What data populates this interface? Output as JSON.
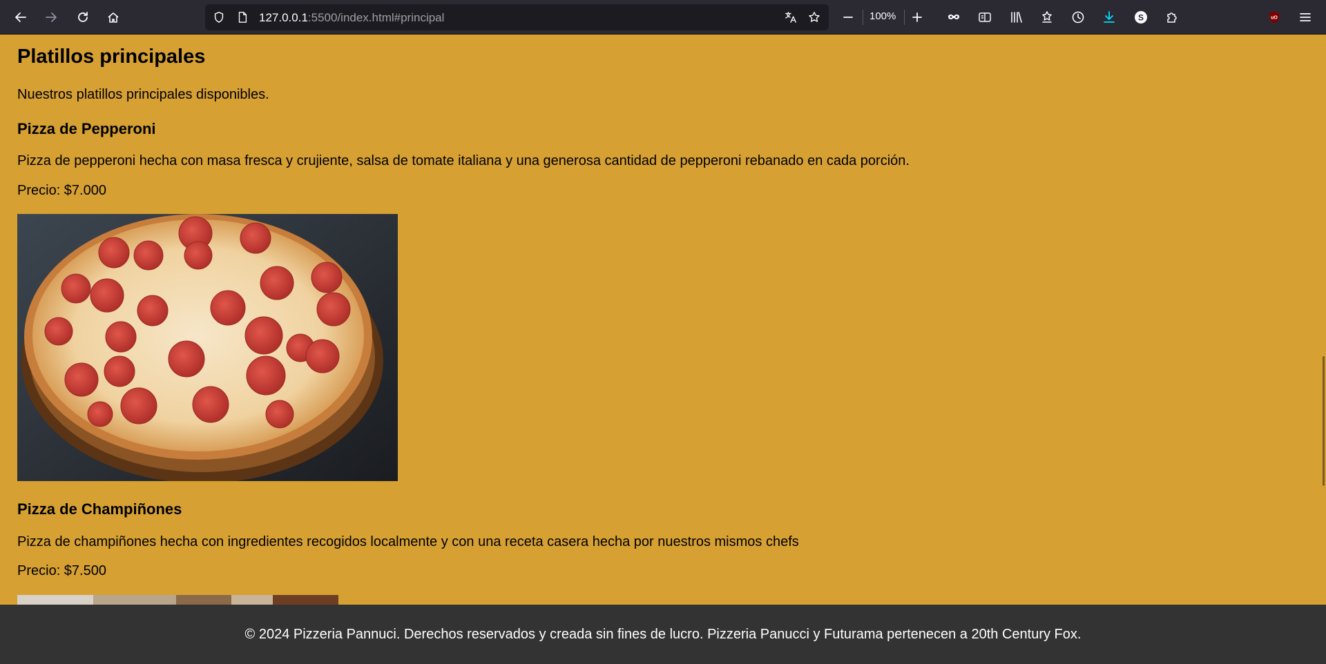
{
  "browser": {
    "url_host": "127.0.0.1",
    "url_rest": ":5500/index.html#principal",
    "zoom": "100%",
    "icons": [
      "back-icon",
      "forward-icon",
      "reload-icon",
      "home-icon",
      "shield-icon",
      "page-icon",
      "translate-icon",
      "bookmark-star-icon",
      "zoom-out-icon",
      "zoom-in-icon",
      "private-mask-icon",
      "reader-view-icon",
      "library-icon",
      "extensions-puzzle-icon",
      "history-icon",
      "download-icon",
      "account-icon",
      "puzzle-icon",
      "ublock-icon",
      "menu-icon"
    ]
  },
  "page": {
    "title": "Platillos principales",
    "intro": "Nuestros platillos principales disponibles.",
    "dishes": [
      {
        "name": "Pizza de Pepperoni",
        "description": "Pizza de pepperoni hecha con masa fresca y crujiente, salsa de tomate italiana y una generosa cantidad de pepperoni rebanado en cada porción.",
        "price": "Precio: $7.000",
        "image_icon": "pepperoni-pizza-image"
      },
      {
        "name": "Pizza de Champiñones",
        "description": "Pizza de champiñones hecha con ingredientes recogidos localmente y con una receta casera hecha por nuestros mismos chefs",
        "price": "Precio: $7.500",
        "image_icon": "mushroom-pizza-image"
      }
    ]
  },
  "footer": {
    "text": "© 2024 Pizzeria Pannuci. Derechos reservados y creada sin fines de lucro. Pizzeria Panucci y Futurama pertenecen a 20th Century Fox."
  },
  "colors": {
    "page_background": "#d6a033",
    "footer_background": "#333333",
    "toolbar_background": "#2b2a33",
    "download_accent": "#00ddff"
  }
}
